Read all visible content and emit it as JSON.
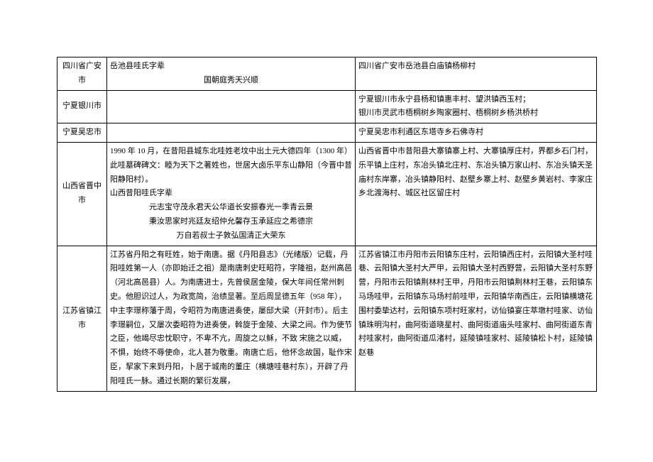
{
  "rows": [
    {
      "loc": "四川省广安市",
      "desc_title": "岳池县哇氏字辈",
      "desc_verse": "国朝庭秀天兴顺",
      "right": "四川省广安市岳池县白庙镇杨柳村"
    },
    {
      "loc": "宁夏银川市",
      "desc": "",
      "right": "宁夏银川市永宁县杨和镇惠丰村、望洪镇西玉村；\n银川市灵武市梧桐树乡陶家圈村、梧桐树乡杨洪桥村"
    },
    {
      "loc": "宁夏吴忠市",
      "desc": "",
      "right": "宁夏吴忠市利通区东塔寺乡石佛寺村"
    },
    {
      "loc": "山西省晋中市",
      "desc_p1": "1990 年 10 月，在昔阳县城东北哇姓老坟中出土元大德四年（1300 年）此哇墓碑碑文：睦为天下之著姓也，世居大卤乐平东山静阳（今晋中昔阳静阳村）。",
      "desc_p2": "山西昔阳哇氏字辈",
      "desc_verse": "元志宝守茂永君天公华道长安振春光一季青云景\n秉汝思家时兆廷友绍仲允馨存玉承延应之希德宗\n万自若叔士子敦弘国清正大荣东",
      "right": "山西省晋中市昔阳县大寨镇寨上村、大寨镇厚庄村，界都乡石门村，乐平镇上庄村，东冶头镇北庄村、东冶头镇万家山村、东冶头镇天圣庙村东岸寨，冶头镇静阳村、赵壁乡寨上村、赵壁乡黄岩村、李家庄乡北渡海村、城区社区留庄村"
    },
    {
      "loc": "江苏省镇江市",
      "desc": "江苏省丹阳之有旺姓，始于南唐。据《丹阳县志》（光绪版）记载，丹阳哇姓第一人（亦即始迁之祖）是南唐刺史旺昭符，字隆祖，赵州高邑（河北高邑县）人。为南唐进士，先曾侯居金陵，保大年间任常州刺史。他胆识过人，为政宽简，治绩显著。至后周显德五年（958 年），中主李璟称藩于周，令昭符为南唐进奏使，屡邸大梁（开封市）。后主李璟嗣位，又屡次委昭符为进奏使，斡旋于金陵、大梁之间。作为使节之臣，他竭尽忠忱职守，不卑不亢，周旋之以稣，不致 宋施之以威，不惧，始终不辱使命，北人甚为敬重。南唐亡后，他怀念故国，耻作宋臣，挈家下来到丹阳，卜居于城南的董庄（横塘哇巷村东），开辟了丹阳哇氏一脉。通过长期的繁衍发展，",
      "right": "江苏省镇江市丹阳市云阳镇东庄村，云阳镇西庄村，云阳镇大圣村哇巷、云阳镇大圣村大严甲，云阳镇大圣村西野营，云阳镇大圣村东野营，丹阳市云阳镇荆林村王甲，丹阳市云阳镇荆林村王巷，云阳镇东马场哇甲，云阳镇东马场村前哇甲，云阳镇华南西庄，云阳镇横塘花围村委挚达村，云阳镇东项村旺家村，访仙镇宴庄萃墩村哇家、访仙镇珠明沟村，曲阿街道晓星村、曲阿街道庙头哇家村、曲阿街道东青村哇家村，曲阿街道瓜渚村，延陵镇哇家村、延陵镇松卜村，延陵镇赵巷"
    }
  ]
}
